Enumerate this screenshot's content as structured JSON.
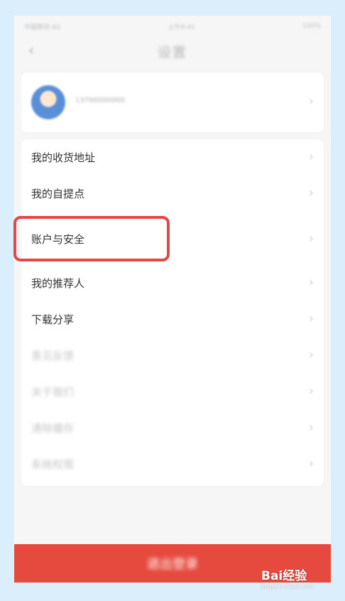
{
  "nav": {
    "title": "设置"
  },
  "status_bar": {
    "left": "中国移动 4G",
    "center": "上午9:41",
    "right": "100%"
  },
  "profile": {
    "name": "13700000000"
  },
  "menu": {
    "items": [
      {
        "label": "我的收货地址"
      },
      {
        "label": "我的自提点"
      },
      {
        "label": "账户与安全"
      },
      {
        "label": "我的推荐人"
      },
      {
        "label": "下载分享"
      },
      {
        "label": "意见反馈"
      },
      {
        "label": "关于我们"
      },
      {
        "label": "清除缓存"
      },
      {
        "label": "系统权限"
      }
    ]
  },
  "logout": {
    "label": "退出登录"
  },
  "watermark": {
    "brand": "Bai经验",
    "sub": "jingyan.baidu.com"
  },
  "colors": {
    "accent": "#e64a3e",
    "highlight_border": "#e6454a",
    "frame": "#dbeefb"
  }
}
